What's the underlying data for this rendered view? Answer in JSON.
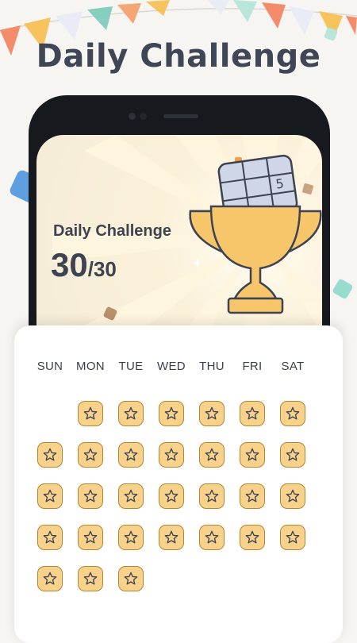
{
  "header": {
    "title": "Daily Challenge"
  },
  "phone_screen": {
    "title": "Daily Challenge",
    "completed": "30",
    "total": "/30"
  },
  "calendar": {
    "weekdays": [
      "SUN",
      "MON",
      "TUE",
      "WED",
      "THU",
      "FRI",
      "SAT"
    ],
    "star_days_count": 30,
    "first_day_offset": 1
  },
  "colors": {
    "headline": "#3f4656",
    "trophy": "#f7c66b",
    "star_tile": "#f8d28a",
    "star_outline": "#b8842d"
  }
}
